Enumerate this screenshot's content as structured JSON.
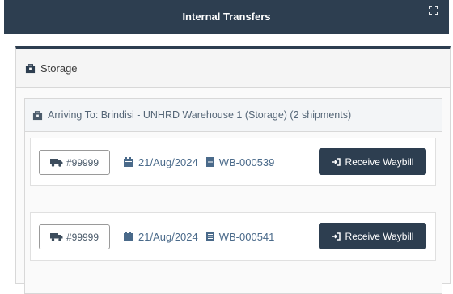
{
  "header": {
    "title": "Internal Transfers",
    "expand_icon": "expand-icon"
  },
  "storage_panel": {
    "title": "Storage",
    "icon": "package-icon",
    "group": {
      "title": "Arriving To: Brindisi - UNHRD Warehouse 1 (Storage) (2 shipments)",
      "icon": "package-icon",
      "shipments": [
        {
          "truck_icon": "truck-icon",
          "number": "#99999",
          "date": "21/Aug/2024",
          "waybill": "WB-000539",
          "button_label": "Receive Waybill"
        },
        {
          "truck_icon": "truck-icon",
          "number": "#99999",
          "date": "21/Aug/2024",
          "waybill": "WB-000541",
          "button_label": "Receive Waybill"
        }
      ]
    }
  },
  "colors": {
    "header_bg": "#2d3e50",
    "button_bg": "#2d3e50",
    "meta_text": "#4a6a8a"
  }
}
